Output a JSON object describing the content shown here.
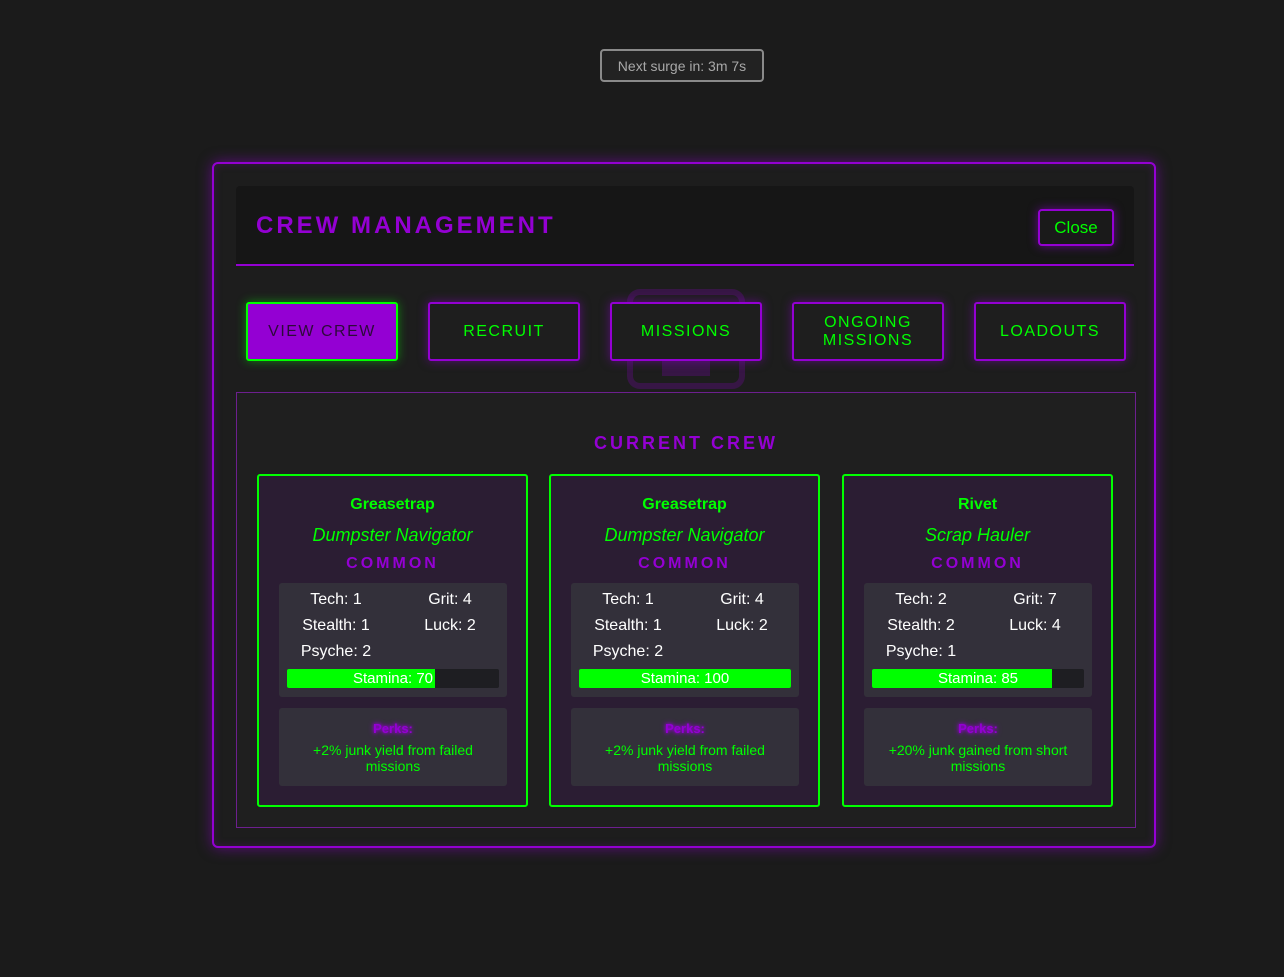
{
  "surge": {
    "label": "Next surge in: 3m 7s"
  },
  "modal": {
    "title": "CREW MANAGEMENT",
    "close_label": "Close"
  },
  "tabs": [
    {
      "label": "VIEW CREW",
      "active": true
    },
    {
      "label": "RECRUIT",
      "active": false
    },
    {
      "label": "MISSIONS",
      "active": false
    },
    {
      "label": "ONGOING MISSIONS",
      "active": false
    },
    {
      "label": "LOADOUTS",
      "active": false
    }
  ],
  "crew": {
    "heading": "CURRENT CREW",
    "members": [
      {
        "name": "Greasetrap",
        "role": "Dumpster Navigator",
        "rarity": "COMMON",
        "tech": "Tech: 1",
        "grit": "Grit: 4",
        "stealth": "Stealth: 1",
        "luck": "Luck: 2",
        "psyche": "Psyche: 2",
        "stamina_label": "Stamina: 70",
        "stamina": 70,
        "perks_title": "Perks:",
        "perk": "+2% junk yield from failed missions"
      },
      {
        "name": "Greasetrap",
        "role": "Dumpster Navigator",
        "rarity": "COMMON",
        "tech": "Tech: 1",
        "grit": "Grit: 4",
        "stealth": "Stealth: 1",
        "luck": "Luck: 2",
        "psyche": "Psyche: 2",
        "stamina_label": "Stamina: 100",
        "stamina": 100,
        "perks_title": "Perks:",
        "perk": "+2% junk yield from failed missions"
      },
      {
        "name": "Rivet",
        "role": "Scrap Hauler",
        "rarity": "COMMON",
        "tech": "Tech: 2",
        "grit": "Grit: 7",
        "stealth": "Stealth: 2",
        "luck": "Luck: 4",
        "psyche": "Psyche: 1",
        "stamina_label": "Stamina: 85",
        "stamina": 85,
        "perks_title": "Perks:",
        "perk": "+20% junk gained from short missions"
      }
    ]
  },
  "colors": {
    "accent": "#9400d3",
    "neon_green": "#00ff00",
    "background": "#1b1b1b"
  }
}
